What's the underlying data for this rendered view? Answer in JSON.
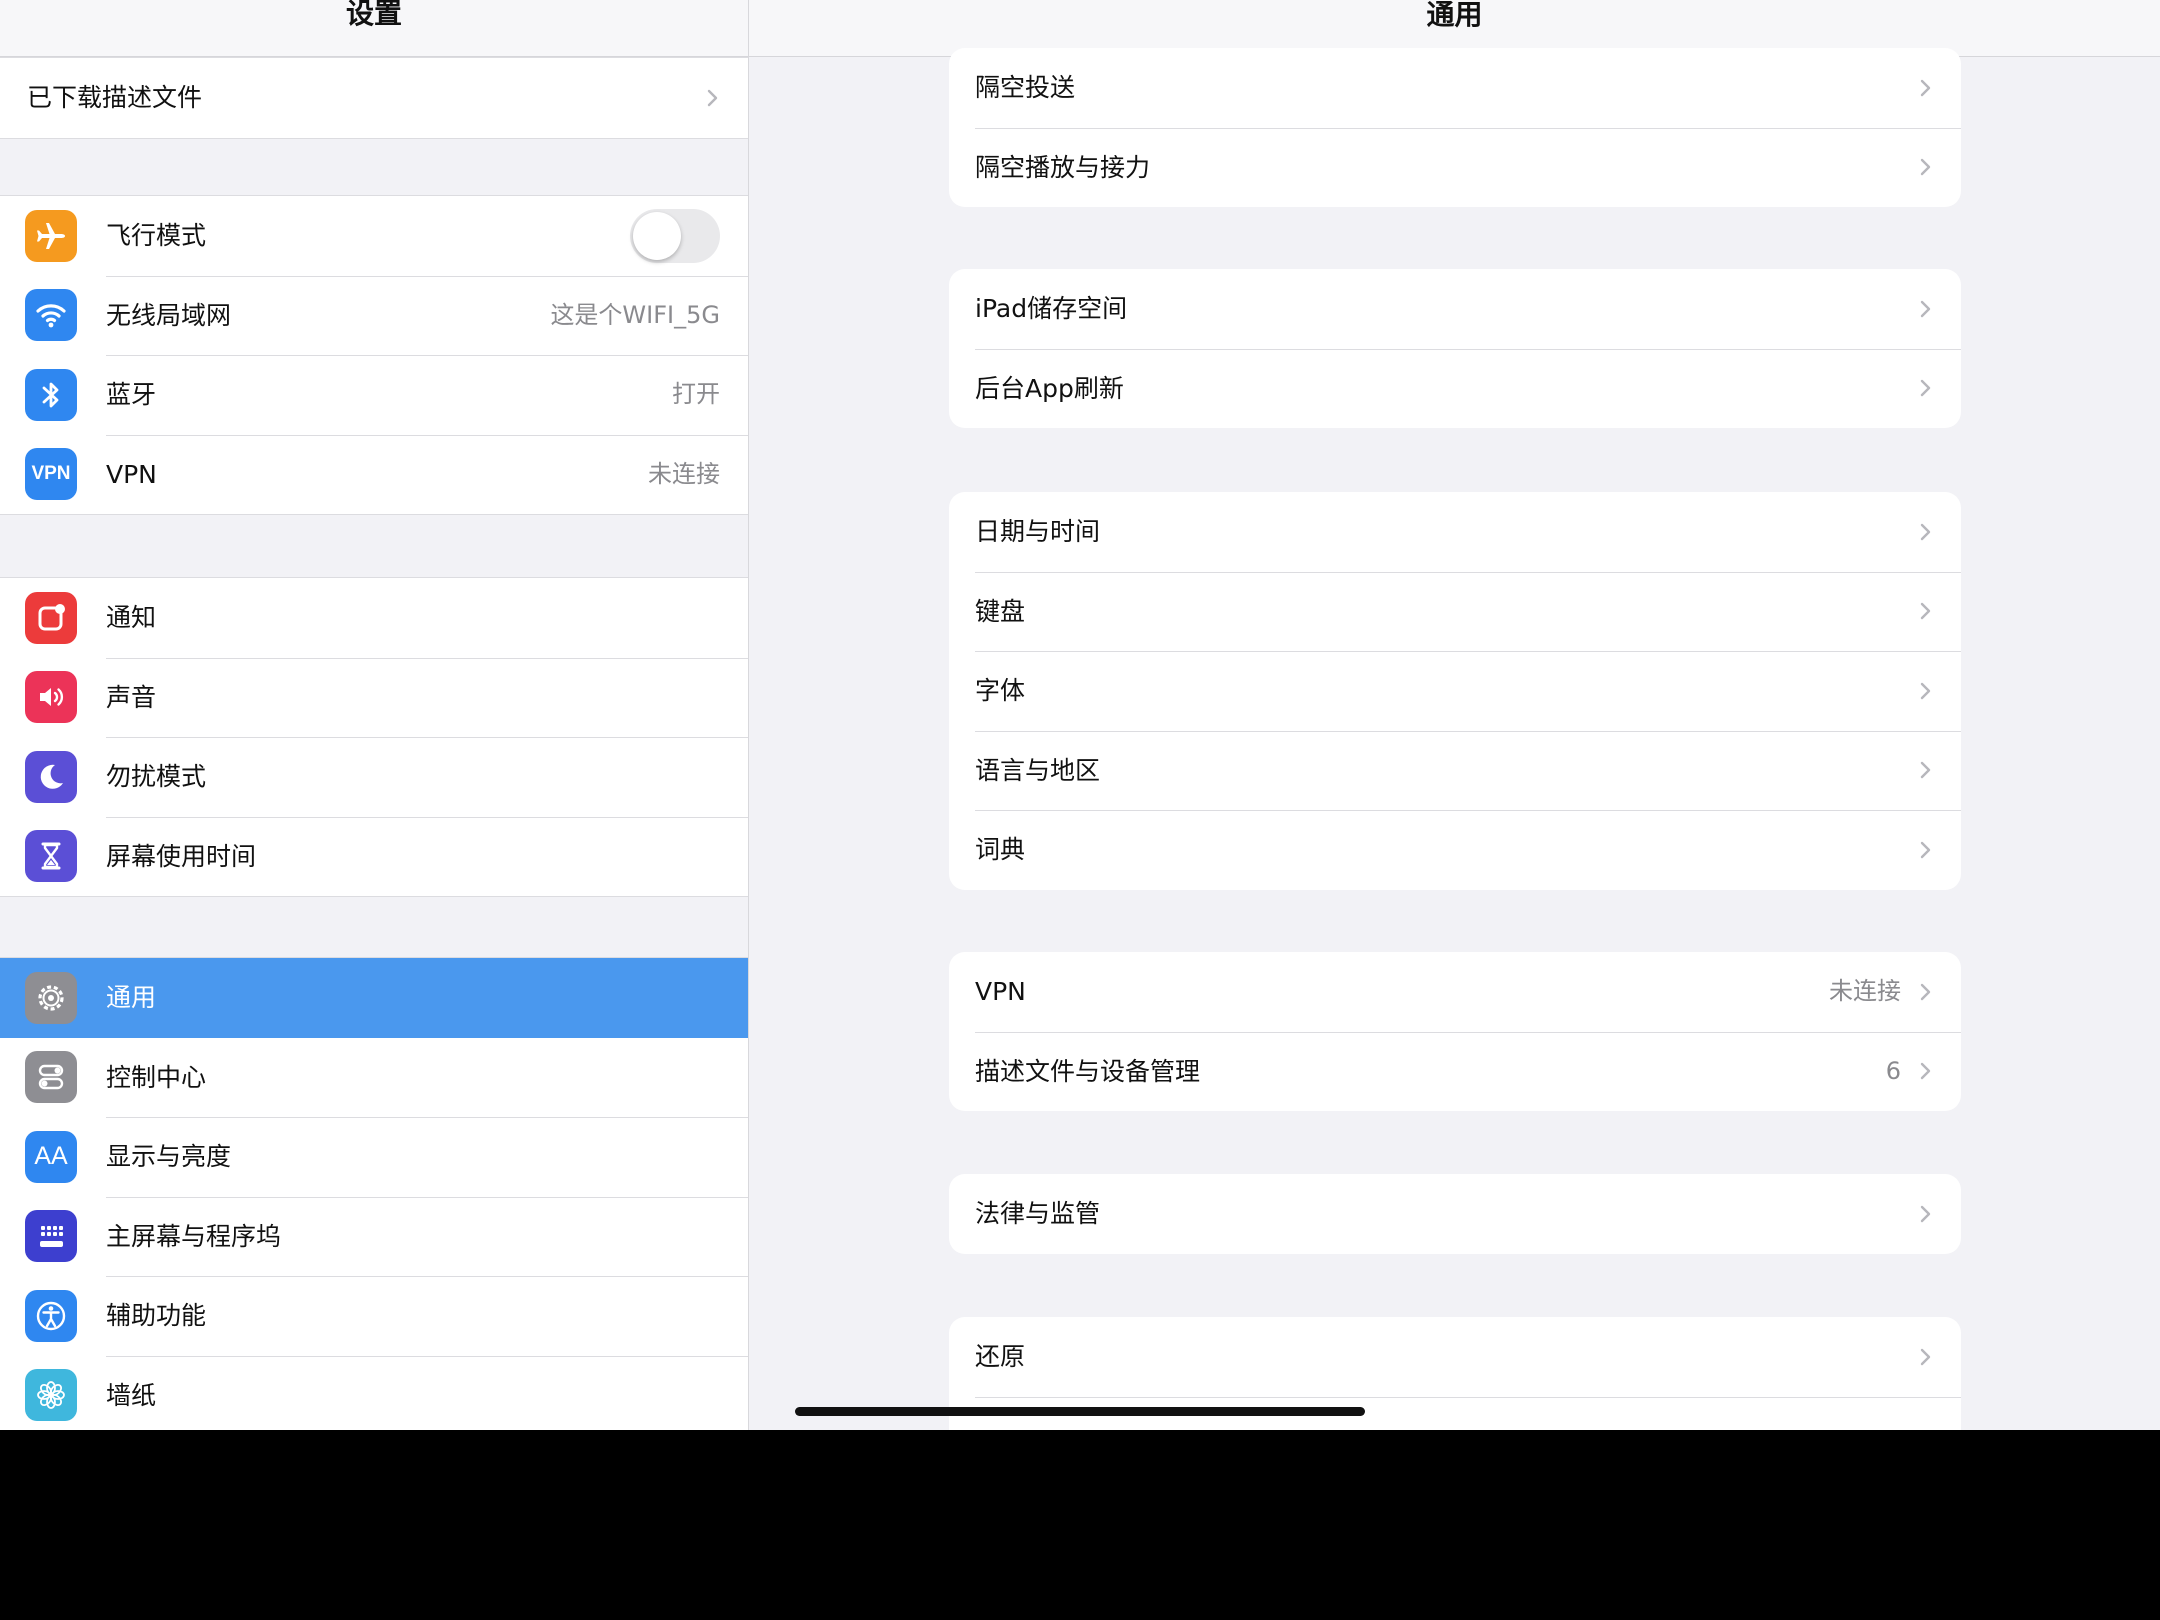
{
  "sidebar": {
    "title": "设置",
    "groups": [
      {
        "rows": [
          {
            "label": "已下载描述文件",
            "chevron": true
          }
        ]
      },
      {
        "rows": [
          {
            "label": "飞行模式",
            "icon": "airplane-icon",
            "color": "#f59a1f",
            "toggle": true,
            "toggle_on": false
          },
          {
            "label": "无线局域网",
            "icon": "wifi-icon",
            "color": "#2f87f0",
            "value": "这是个WIFI_5G"
          },
          {
            "label": "蓝牙",
            "icon": "bluetooth-icon",
            "color": "#2f87f0",
            "value": "打开"
          },
          {
            "label": "VPN",
            "icon": "vpn-icon",
            "icon_text": "VPN",
            "color": "#2f87f0",
            "value": "未连接"
          }
        ]
      },
      {
        "rows": [
          {
            "label": "通知",
            "icon": "notifications-icon",
            "color": "#ec3b3b"
          },
          {
            "label": "声音",
            "icon": "speaker-icon",
            "color": "#ec3358"
          },
          {
            "label": "勿扰模式",
            "icon": "moon-icon",
            "color": "#5b4fd6"
          },
          {
            "label": "屏幕使用时间",
            "icon": "hourglass-icon",
            "color": "#5b4fd6"
          }
        ]
      },
      {
        "rows": [
          {
            "label": "通用",
            "icon": "gear-icon",
            "color": "#8e8e93",
            "selected": true
          },
          {
            "label": "控制中心",
            "icon": "switches-icon",
            "color": "#8e8e93"
          },
          {
            "label": "显示与亮度",
            "icon": "text-size-icon",
            "icon_text": "AA",
            "color": "#2f87f0"
          },
          {
            "label": "主屏幕与程序坞",
            "icon": "home-grid-icon",
            "color": "#3d3fcf"
          },
          {
            "label": "辅助功能",
            "icon": "accessibility-icon",
            "color": "#2f87f0"
          },
          {
            "label": "墙纸",
            "icon": "flower-icon",
            "color": "#3fb7dd"
          }
        ]
      }
    ]
  },
  "detail": {
    "title": "通用",
    "groups": [
      {
        "rows": [
          {
            "label": "隔空投送"
          },
          {
            "label": "隔空播放与接力"
          }
        ]
      },
      {
        "rows": [
          {
            "label": "iPad储存空间"
          },
          {
            "label": "后台App刷新"
          }
        ]
      },
      {
        "rows": [
          {
            "label": "日期与时间"
          },
          {
            "label": "键盘"
          },
          {
            "label": "字体"
          },
          {
            "label": "语言与地区"
          },
          {
            "label": "词典"
          }
        ]
      },
      {
        "rows": [
          {
            "label": "VPN",
            "value": "未连接"
          },
          {
            "label": "描述文件与设备管理",
            "value": "6"
          }
        ]
      },
      {
        "rows": [
          {
            "label": "法律与监管"
          }
        ]
      },
      {
        "rows": [
          {
            "label": "还原"
          }
        ]
      }
    ]
  }
}
